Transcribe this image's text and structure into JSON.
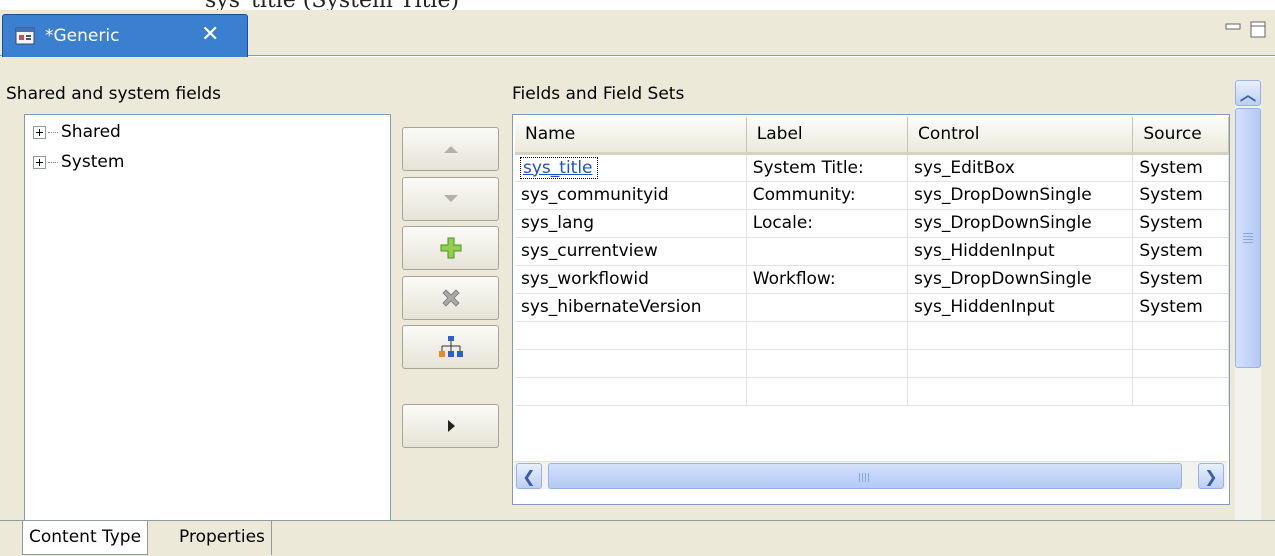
{
  "window": {
    "top_text": "sys_title (System Title)",
    "tab_label": "*Generic",
    "tab_icon": "content-type-icon"
  },
  "left_panel": {
    "title": "Shared and system fields",
    "tree": [
      {
        "label": "Shared"
      },
      {
        "label": "System"
      }
    ]
  },
  "toolbar": {
    "buttons": [
      {
        "icon": "move-up-icon"
      },
      {
        "icon": "move-down-icon"
      },
      {
        "icon": "add-icon"
      },
      {
        "icon": "delete-icon"
      },
      {
        "icon": "hierarchy-icon"
      },
      {
        "icon": "expand-arrow-icon"
      }
    ]
  },
  "right_panel": {
    "title": "Fields and Field Sets",
    "columns": [
      "Name",
      "Label",
      "Control",
      "Source"
    ],
    "rows": [
      {
        "name": "sys_title",
        "label": "System Title:",
        "control": "sys_EditBox",
        "source": "System"
      },
      {
        "name": "sys_communityid",
        "label": "Community:",
        "control": "sys_DropDownSingle",
        "source": "System"
      },
      {
        "name": "sys_lang",
        "label": "Locale:",
        "control": "sys_DropDownSingle",
        "source": "System"
      },
      {
        "name": "sys_currentview",
        "label": "",
        "control": "sys_HiddenInput",
        "source": "System"
      },
      {
        "name": "sys_workflowid",
        "label": "Workflow:",
        "control": "sys_DropDownSingle",
        "source": "System"
      },
      {
        "name": "sys_hibernateVersion",
        "label": "",
        "control": "sys_HiddenInput",
        "source": "System"
      }
    ]
  },
  "bottom_tabs": {
    "content_type": "Content Type",
    "properties": "Properties"
  },
  "colors": {
    "tab_active": "#3a7fd0",
    "panel_bg": "#ece9d8",
    "link": "#1e50c8"
  }
}
